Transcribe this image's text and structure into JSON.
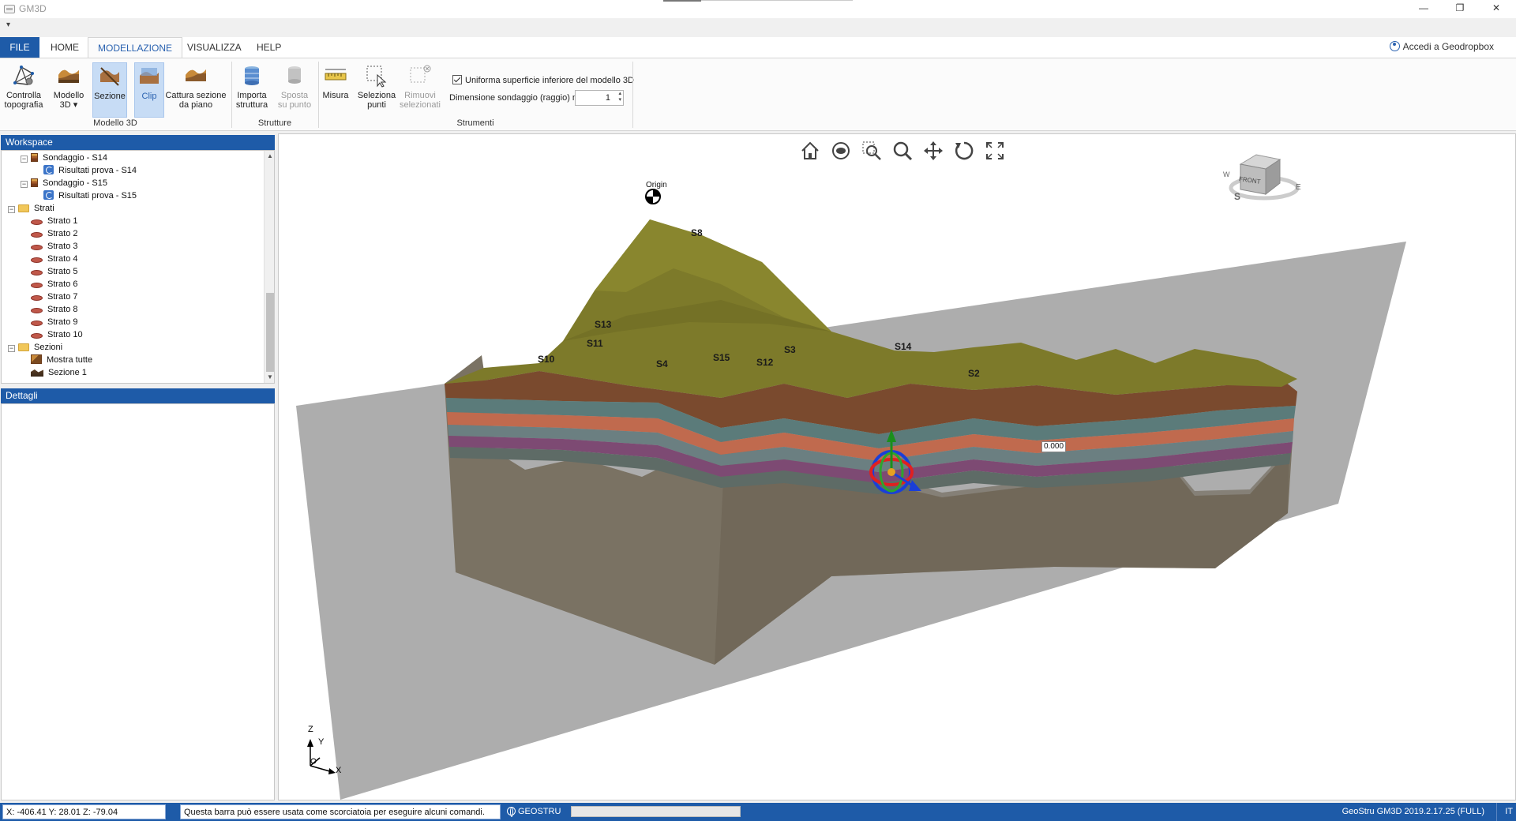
{
  "window": {
    "title": "GM3D",
    "minimize": "—",
    "restore": "❐",
    "close": "✕",
    "qat": "▾"
  },
  "tabs": [
    "FILE",
    "HOME",
    "MODELLAZIONE",
    "VISUALIZZA",
    "HELP"
  ],
  "login": "Accedi a Geodropbox",
  "ribbon": {
    "buttons": {
      "controlla": "Controlla topografia",
      "modello": "Modello 3D ▾",
      "sezione": "Sezione",
      "clip": "Clip",
      "cattura": "Cattura sezione da piano",
      "importa": "Importa struttura",
      "sposta": "Sposta su punto",
      "misura": "Misura",
      "seleziona": "Seleziona punti",
      "rimuovi": "Rimuovi selezionati"
    },
    "groups": {
      "modello3d": "Modello 3D",
      "strutture": "Strutture",
      "strumenti": "Strumenti"
    },
    "uniforma_label": "Uniforma superficie inferiore del modello 3D",
    "dimensione_label": "Dimensione sondaggio (raggio) m",
    "dimensione_value": "1"
  },
  "workspace": {
    "title": "Workspace",
    "tree": [
      {
        "label": "Sondaggio - S14",
        "type": "bore",
        "indent": 1,
        "expander": "−"
      },
      {
        "label": "Risultati prova - S14",
        "type": "res",
        "indent": 2
      },
      {
        "label": "Sondaggio - S15",
        "type": "bore",
        "indent": 1,
        "expander": "−"
      },
      {
        "label": "Risultati prova - S15",
        "type": "res",
        "indent": 2
      },
      {
        "label": "Strati",
        "type": "folder",
        "indent": 0,
        "expander": "−"
      },
      {
        "label": "Strato 1",
        "type": "strato",
        "indent": 1
      },
      {
        "label": "Strato 2",
        "type": "strato",
        "indent": 1
      },
      {
        "label": "Strato 3",
        "type": "strato",
        "indent": 1
      },
      {
        "label": "Strato 4",
        "type": "strato",
        "indent": 1
      },
      {
        "label": "Strato 5",
        "type": "strato",
        "indent": 1
      },
      {
        "label": "Strato 6",
        "type": "strato",
        "indent": 1
      },
      {
        "label": "Strato 7",
        "type": "strato",
        "indent": 1
      },
      {
        "label": "Strato 8",
        "type": "strato",
        "indent": 1
      },
      {
        "label": "Strato 9",
        "type": "strato",
        "indent": 1
      },
      {
        "label": "Strato 10",
        "type": "strato",
        "indent": 1
      },
      {
        "label": "Sezioni",
        "type": "folder",
        "indent": 0,
        "expander": "−"
      },
      {
        "label": "Mostra tutte",
        "type": "show",
        "indent": 1
      },
      {
        "label": "Sezione 1",
        "type": "sez",
        "indent": 1
      }
    ]
  },
  "details": {
    "title": "Dettagli"
  },
  "viewport": {
    "origin_label": "Origin",
    "gizmo_value": "0.000",
    "navcube_face": "FRONT",
    "compass": {
      "s": "S",
      "e": "E",
      "w": "W"
    },
    "axes": {
      "x": "X",
      "y": "Y",
      "z": "Z"
    },
    "boreholes": [
      "S8",
      "S13",
      "S11",
      "S10",
      "S4",
      "S15",
      "S3",
      "S12",
      "S14",
      "S2"
    ]
  },
  "status": {
    "coords": "X: -406.41   Y: 28.01   Z: -79.04",
    "command_hint": "Questa barra può essere usata come scorciatoia per eseguire alcuni comandi.",
    "brand": "GEOSTRU",
    "version": "GeoStru GM3D 2019.2.17.25 (FULL)",
    "lang": "IT"
  },
  "colors": {
    "accent": "#1e5ba8",
    "terrain": "#7d7a2a",
    "layers": [
      "#7a4a2e",
      "#5b7b7a",
      "#c06a4e",
      "#7d4a73",
      "#6b7f81",
      "#a87050",
      "#6b3a66"
    ]
  }
}
